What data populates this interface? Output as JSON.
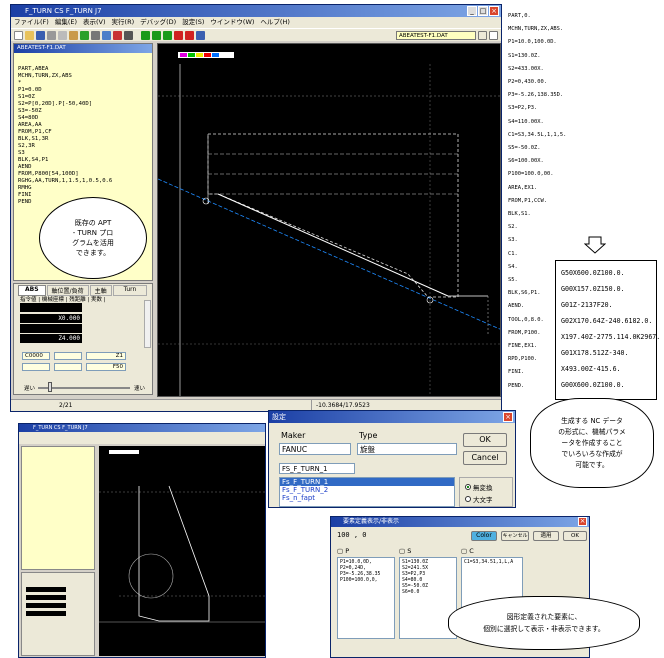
{
  "main_window": {
    "title": "F_TURN CS F_TURN J7",
    "menu": [
      "ファイル(F)",
      "編集(E)",
      "表示(V)",
      "実行(R)",
      "デバッグ(D)",
      "設定(S)",
      "ウインドウ(W)",
      "ヘルプ(H)"
    ],
    "file_field": "ABEATEST-F1.DAT",
    "editor_title": "ABEATEST-F1.DAT",
    "source_lines": [
      "PART,ABEA",
      "MCHN,TURN,ZX,ABS",
      "*",
      "P1=0.0D",
      "S1=0Z",
      "S2=P[0,20D].P[-50,40D]",
      "S3=-50Z",
      "S4=80D",
      "AREA,AA",
      "FROM,P1,CF",
      "BLK,S1,3R",
      "S2,3R",
      "S3",
      "BLK,S4,P1",
      "AEND",
      "FROM,P800[54,100D]",
      "RGHG,AA,TURN,1,1.5,1,0.5,0.6",
      "RMHG",
      "FINI",
      "PEND"
    ],
    "tabs": [
      "ABS",
      "軸位置/負荷",
      "主軸",
      "Turn"
    ],
    "subtabs": "指令値 | 機械座標 | 残距離 | 実数 |",
    "pos_values": [
      "X0.000",
      "Z4.000"
    ],
    "status_fields": [
      "C0000",
      "Z1",
      "F50"
    ],
    "speed_low": "遅い",
    "speed_high": "速い",
    "status_bar_left": "2/21",
    "status_bar_coords": "-10.3684/17.9523"
  },
  "callout_left": "既存の APT\n- TURN プロ\nグラムを活用\nできます。",
  "apt_listing": [
    "PART,0.",
    "MCHN,TURN,ZX,ABS.",
    "P1=10.0,100.0D.",
    "S1=130.0Z.",
    "S2=433.00X.",
    "P2=0,430.00.",
    "P3=-5.26,138.35D.",
    "S3=P2,P3.",
    "S4=110.00X.",
    "C1=S3,34.5L,1,1,5.",
    "S5=-50.0Z.",
    "S6=100.00X.",
    "P100=100.0,00.",
    "AREA,EX1.",
    "FROM,P1,CCW.",
    "BLK,S1.",
    "S2.",
    "S3.",
    "C1.",
    "S4.",
    "S5.",
    "BLK,S6,P1.",
    "AEND.",
    "TOOL,0,8.0.",
    "FROM,P100.",
    "FINE,EX1.",
    "RPD,P100.",
    "FINI.",
    "PEND."
  ],
  "nc_code": [
    "G50X600.0Z100.0.",
    "G00X157.0Z150.0.",
    "G01Z-2137F20.",
    "G02X170.64Z-240.6182.0.",
    "X197.40Z-2775.114.0K2967.",
    "G01X178.512Z-340.",
    "X493.00Z-415.6.",
    "G00X600.0Z100.0."
  ],
  "callout_right": "生成する NC データ\nの形式に、機械パラメ\nータを作成すること\nでいろいろな作成が\n可能です。",
  "settings_dialog": {
    "title": "設定",
    "maker_label": "Maker",
    "type_label": "Type",
    "maker_value": "FANUC",
    "type_value": "旋盤",
    "post_value": "FS_F_TURN_1",
    "posts": [
      "Fs_F_TURN_1",
      "Fs_F_TURN_2",
      "Fs_n_fapt"
    ],
    "ok": "OK",
    "cancel": "Cancel",
    "radio_none": "無変換",
    "radio_upper": "大文字"
  },
  "display_dialog": {
    "title": "要素定義表示/非表示",
    "id_value": "100 , 0",
    "color_btn": "Color",
    "cancel_btn": "キャンセル",
    "apply_btn": "適用",
    "ok_btn": "OK",
    "cols": [
      {
        "label": "P",
        "items": [
          "P1=10.0,0D,",
          "P2=0,24D,",
          "P3=-5.26,38.35",
          "P100=100.0,0,"
        ]
      },
      {
        "label": "S",
        "items": [
          "S1=130.0Z",
          "S2=241.5X",
          "S3=P2,P3",
          "S4=80.0",
          "S5=-50.0Z",
          "S6=0.0"
        ]
      },
      {
        "label": "C",
        "items": [
          "C1=S3,34.51,1,L,A"
        ]
      }
    ]
  },
  "callout_bottom": "図形定義された要素に、\n個別に選択して表示・非表示できます。",
  "second_window": {
    "title": "F_TURN CS F_TURN J7"
  }
}
